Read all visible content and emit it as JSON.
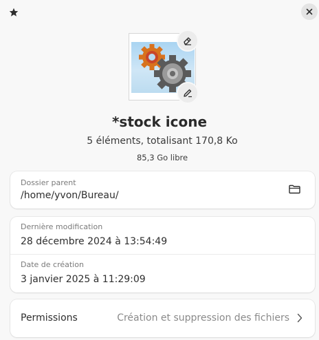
{
  "header": {
    "star_icon": "star-icon",
    "close_icon": "close-icon"
  },
  "file": {
    "name": "*stock icone",
    "summary": "5 éléments, totalisant 170,8 Ko",
    "free_space": "85,3 Go libre"
  },
  "parent_folder": {
    "label": "Dossier parent",
    "value": "/home/yvon/Bureau/",
    "open_icon": "folder-icon"
  },
  "dates": {
    "modified_label": "Dernière modification",
    "modified_value": "28 décembre 2024 à 13:54:49",
    "created_label": "Date de création",
    "created_value": "3 janvier 2025 à 11:29:09"
  },
  "permissions": {
    "label": "Permissions",
    "value": "Création et suppression des fichiers",
    "chevron_icon": "chevron-right-icon"
  },
  "colors": {
    "background": "#f8f8f8",
    "card": "#ffffff",
    "muted_text": "#7a7a7a"
  }
}
